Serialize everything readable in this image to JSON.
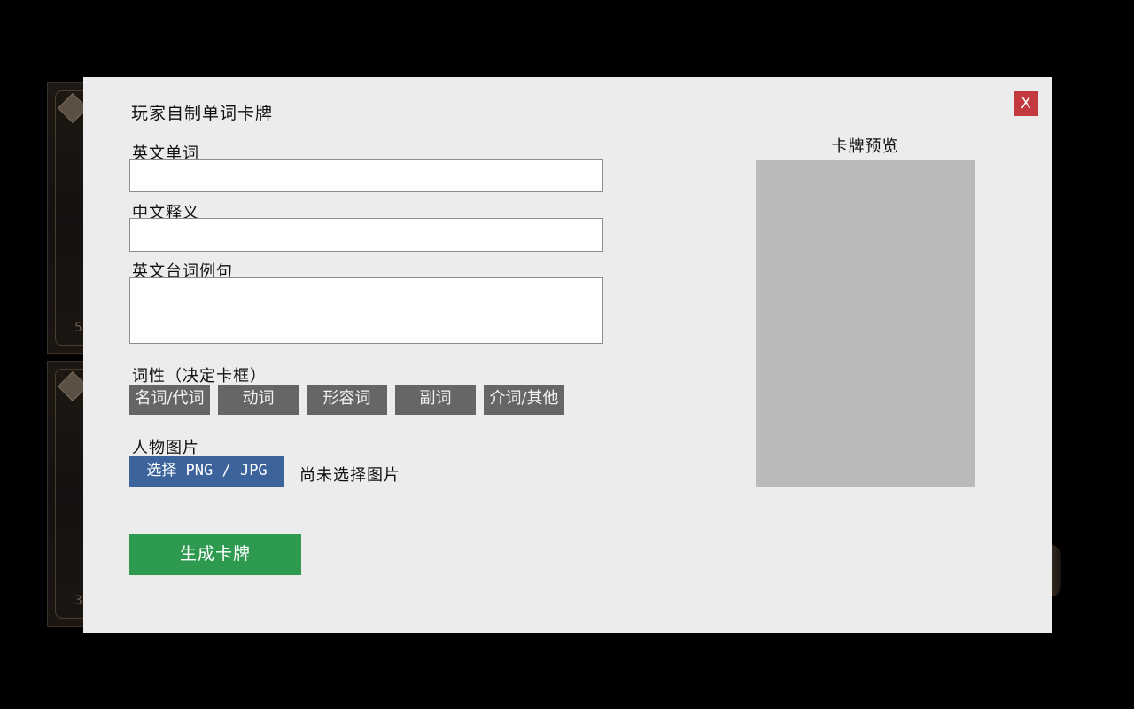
{
  "background": {
    "card_numbers": [
      "5",
      "3"
    ]
  },
  "modal": {
    "title": "玩家自制单词卡牌",
    "close_label": "X",
    "fields": {
      "english_word_label": "英文单词",
      "english_word_value": "",
      "chinese_meaning_label": "中文释义",
      "chinese_meaning_value": "",
      "example_sentence_label": "英文台词例句",
      "example_sentence_value": ""
    },
    "part_of_speech": {
      "label": "词性（决定卡框）",
      "options": [
        "名词/代词",
        "动词",
        "形容词",
        "副词",
        "介词/其他"
      ]
    },
    "image": {
      "label": "人物图片",
      "pick_button": "选择 PNG / JPG",
      "status": "尚未选择图片"
    },
    "generate_button": "生成卡牌",
    "preview": {
      "title": "卡牌预览"
    }
  },
  "colors": {
    "modal_bg": "#ececec",
    "close_red": "#c23a3f",
    "pos_gray": "#666666",
    "pick_blue": "#3d639c",
    "generate_green": "#2e9a50",
    "preview_gray": "#bababa"
  }
}
